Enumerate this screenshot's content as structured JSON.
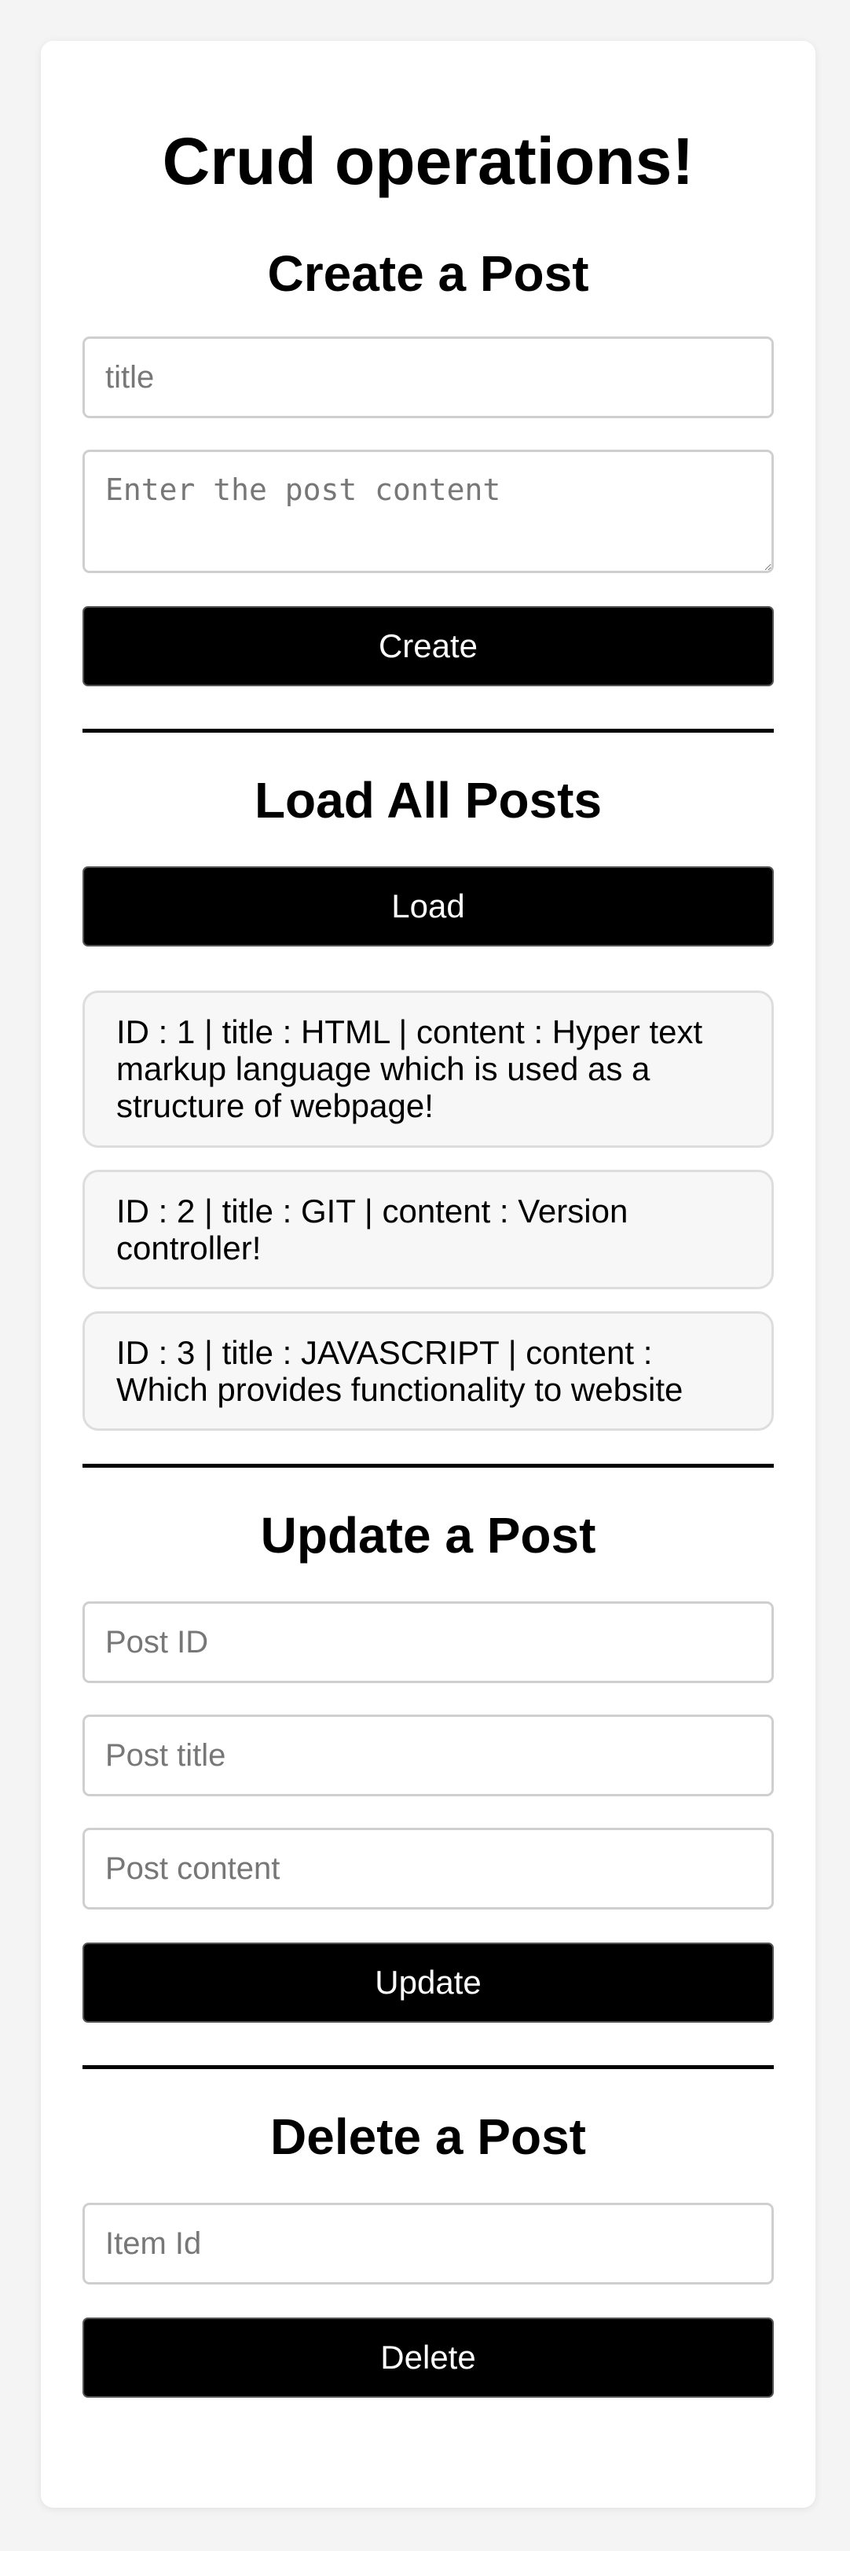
{
  "page_title": "Crud operations!",
  "create": {
    "heading": "Create a Post",
    "title_placeholder": "title",
    "content_placeholder": "Enter the post content",
    "button_label": "Create"
  },
  "load": {
    "heading": "Load All Posts",
    "button_label": "Load",
    "posts": [
      "ID : 1 | title : HTML | content : Hyper text markup language which is used as a structure of webpage!",
      "ID : 2 | title : GIT | content : Version controller!",
      "ID : 3 | title : JAVASCRIPT | content : Which provides functionality to website"
    ]
  },
  "update": {
    "heading": "Update a Post",
    "id_placeholder": "Post ID",
    "title_placeholder": "Post title",
    "content_placeholder": "Post content",
    "button_label": "Update"
  },
  "delete": {
    "heading": "Delete a Post",
    "id_placeholder": "Item Id",
    "button_label": "Delete"
  }
}
